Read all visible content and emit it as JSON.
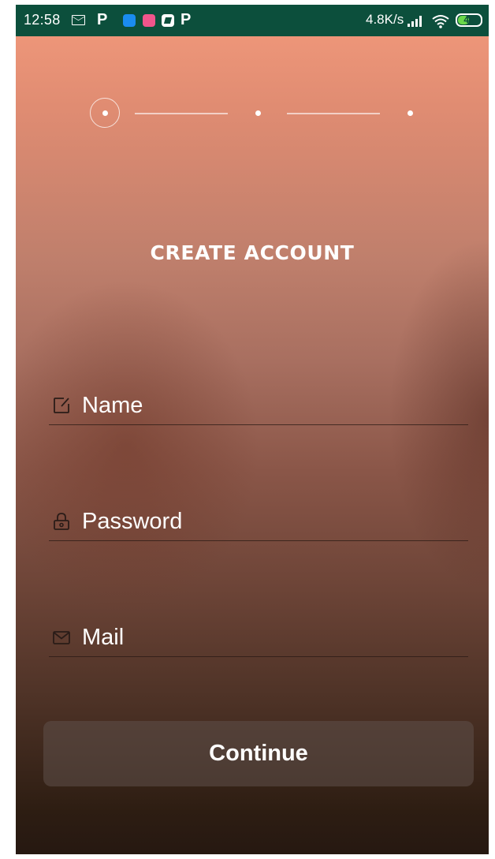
{
  "status_bar": {
    "time": "12:58",
    "network_speed": "4.8K/s",
    "battery_level": "48",
    "background_color": "#0c4f3c",
    "icons": [
      "mail-icon",
      "p-app-icon",
      "zhihu-app-icon",
      "pink-app-icon",
      "z-app-icon",
      "p-app-icon",
      "signal-icon",
      "wifi-icon",
      "battery-icon"
    ]
  },
  "stepper": {
    "total_steps": 3,
    "current_step": 1
  },
  "form": {
    "title": "CREATE ACCOUNT",
    "fields": [
      {
        "icon": "edit-icon",
        "placeholder": "Name",
        "value": ""
      },
      {
        "icon": "lock-icon",
        "placeholder": "Password",
        "value": ""
      },
      {
        "icon": "mail-icon",
        "placeholder": "Mail",
        "value": ""
      }
    ],
    "continue_label": "Continue"
  },
  "colors": {
    "gradient_top": "#f39a7c",
    "gradient_bottom": "#261811",
    "text": "#ffffff"
  }
}
